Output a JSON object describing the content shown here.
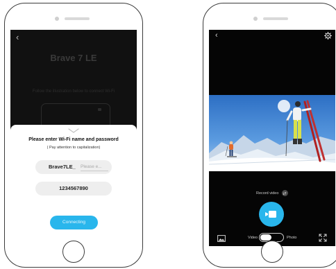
{
  "left_screen": {
    "back_icon": "chevron-left-icon",
    "background_title": "Brave 7 LE",
    "background_instruction": "Follow the illustration below to connect Wi-Fi",
    "sheet": {
      "title": "Please enter Wi-Fi name and password",
      "subtitle": "( Pay attention to capitalization)",
      "ssid_prefix": "Brave7LE_",
      "ssid_placeholder": "Please e...",
      "password_value": "1234567890",
      "connect_label": "Connecting",
      "accent_color": "#29b6ec"
    }
  },
  "right_screen": {
    "back_icon": "chevron-left-icon",
    "settings_icon": "gear-icon",
    "record_label": "Record video",
    "mode_left_label": "Video",
    "mode_right_label": "Photo",
    "mode_selected": "Video",
    "shutter_color": "#29b6ec",
    "gallery_icon": "gallery-icon",
    "fullscreen_icon": "fullscreen-icon"
  }
}
